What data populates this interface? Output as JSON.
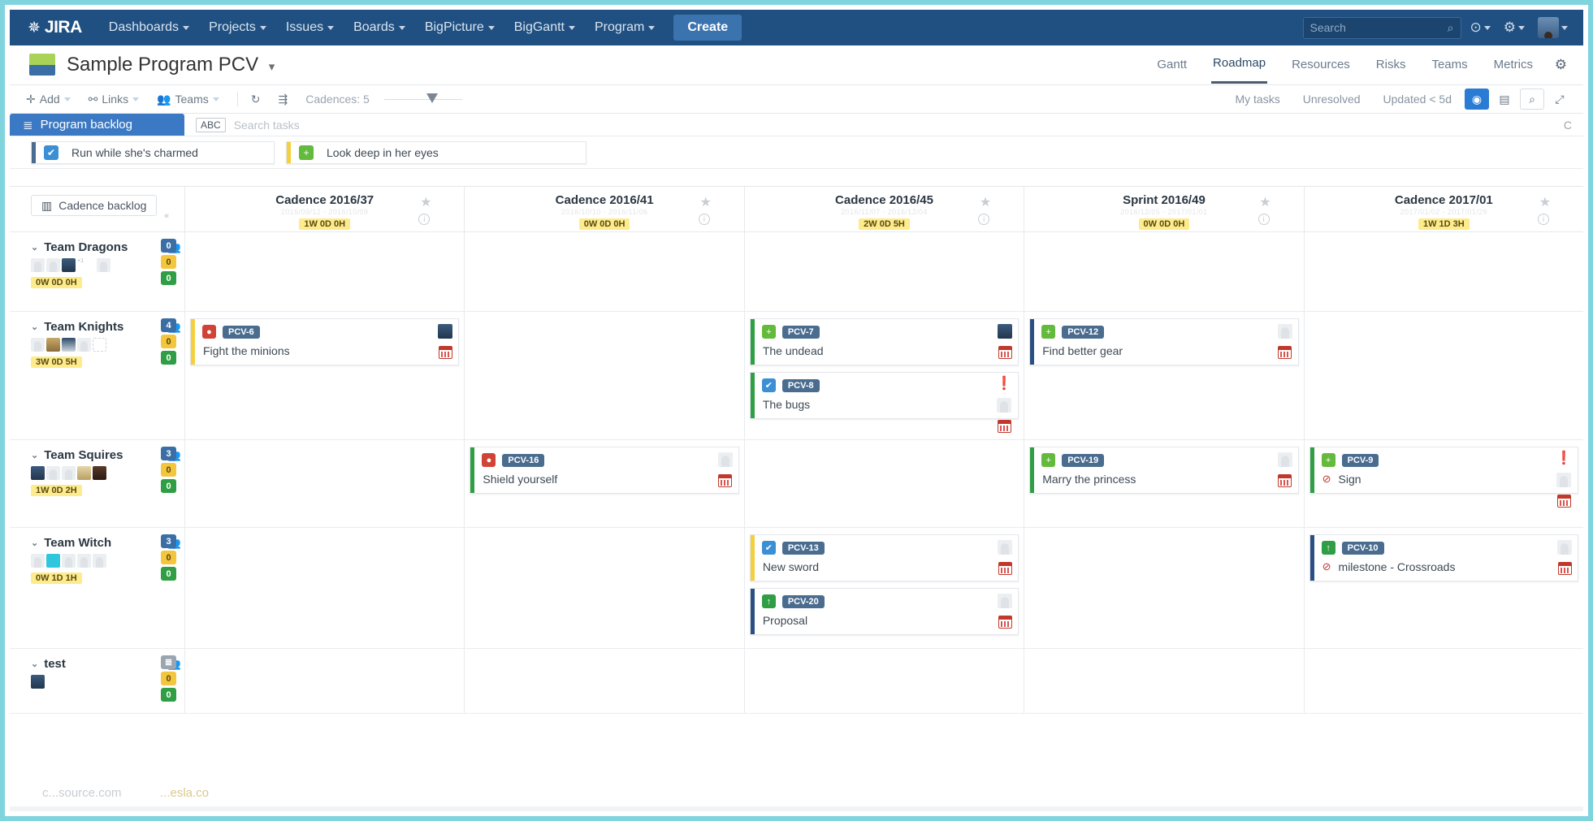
{
  "topnav": {
    "logo_mark": "✵",
    "logo_word": "JIRA",
    "items": [
      {
        "label": "Dashboards",
        "caret": true
      },
      {
        "label": "Projects",
        "caret": true
      },
      {
        "label": "Issues",
        "caret": true
      },
      {
        "label": "Boards",
        "caret": true
      },
      {
        "label": "BigPicture",
        "caret": true
      },
      {
        "label": "BigGantt",
        "caret": true
      },
      {
        "label": "Program",
        "caret": true
      }
    ],
    "create_label": "Create",
    "search_placeholder": "Search",
    "help_icon": "?",
    "settings_icon": "⚙"
  },
  "project": {
    "title": "Sample Program PCV",
    "title_caret": "▾",
    "tabs": [
      {
        "label": "Gantt",
        "active": false
      },
      {
        "label": "Roadmap",
        "active": true
      },
      {
        "label": "Resources",
        "active": false
      },
      {
        "label": "Risks",
        "active": false
      },
      {
        "label": "Teams",
        "active": false
      },
      {
        "label": "Metrics",
        "active": false
      }
    ],
    "settings_icon": "⚙"
  },
  "toolbar": {
    "add_label": "Add",
    "links_label": "Links",
    "teams_label": "Teams",
    "refresh_icon": "↻",
    "filter_icon": "⇶",
    "cadences_label": "Cadences: 5",
    "right": {
      "my_tasks": "My tasks",
      "unresolved": "Unresolved",
      "updated": "Updated < 5d",
      "bolt_icon": "⚡",
      "calendar_icon": "📅",
      "search_icon": "⌕",
      "expand_icon": "⤢"
    }
  },
  "backlog": {
    "tab_label": "Program backlog",
    "tab_icon": "≣",
    "abc_chip": "ABC",
    "search_placeholder": "Search tasks",
    "right_hint": "C",
    "items": [
      {
        "title": "Run while she's charmed",
        "type": "task",
        "type_glyph": "✔",
        "type_color": "#3b8fd4",
        "stripe": "#4a6c8f"
      },
      {
        "title": "Look deep in her eyes",
        "type": "story",
        "type_glyph": "+",
        "type_color": "#63ba3c",
        "stripe": "#f4d03f"
      }
    ]
  },
  "grid": {
    "cadence_backlog_label": "Cadence backlog",
    "cadence_backlog_icon": "▥",
    "collapse_icon": "«",
    "columns": [
      {
        "title": "Cadence 2016/37",
        "ghost": "2016/09/12 - 2016/10/09",
        "estimate": "1W 0D 0H"
      },
      {
        "title": "Cadence 2016/41",
        "ghost": "2016/10/10 - 2016/11/06",
        "estimate": "0W 0D 0H"
      },
      {
        "title": "Cadence 2016/45",
        "ghost": "2016/11/07 - 2016/12/04",
        "estimate": "2W 0D 5H"
      },
      {
        "title": "Sprint 2016/49",
        "ghost": "2016/12/05 - 2017/01/01",
        "estimate": "0W 0D 0H"
      },
      {
        "title": "Cadence 2017/01",
        "ghost": "2017/01/02 - 2017/01/29",
        "estimate": "1W 1D 3H"
      }
    ]
  },
  "teams": [
    {
      "name": "Team Dragons",
      "badges": {
        "blue": "0",
        "yellow": "0",
        "green": "0"
      },
      "estimate": "0W 0D 0H",
      "avatars": [
        "ghost",
        "ghost",
        "p1",
        "tiny",
        "ghost"
      ],
      "cells": [
        [],
        [],
        [],
        [],
        []
      ]
    },
    {
      "name": "Team Knights",
      "badges": {
        "blue": "4",
        "yellow": "0",
        "green": "0"
      },
      "estimate": "3W 0D 5H",
      "avatars": [
        "ghost",
        "p2",
        "p3",
        "ghost",
        "dots"
      ],
      "cells": [
        [
          {
            "key": "PCV-6",
            "summary": "Fight the minions",
            "type_glyph": "●",
            "type_color": "#d04437",
            "stripe": "#f4d03f",
            "avatar": "p1",
            "calendar": true,
            "warning": false,
            "blocked": false
          }
        ],
        [],
        [
          {
            "key": "PCV-7",
            "summary": "The undead",
            "type_glyph": "+",
            "type_color": "#63ba3c",
            "stripe": "#2f9e44",
            "avatar": "p1",
            "calendar": true,
            "warning": false,
            "blocked": false
          },
          {
            "key": "PCV-8",
            "summary": "The bugs",
            "type_glyph": "✔",
            "type_color": "#3b8fd4",
            "stripe": "#2f9e44",
            "avatar": "ghost",
            "calendar": true,
            "warning": true,
            "blocked": false
          }
        ],
        [
          {
            "key": "PCV-12",
            "summary": "Find better gear",
            "type_glyph": "+",
            "type_color": "#63ba3c",
            "stripe": "#2b4f81",
            "avatar": "ghost",
            "calendar": true,
            "warning": false,
            "blocked": false
          }
        ],
        []
      ]
    },
    {
      "name": "Team Squires",
      "badges": {
        "blue": "3",
        "yellow": "0",
        "green": "0"
      },
      "estimate": "1W 0D 2H",
      "avatars": [
        "p1",
        "ghost",
        "ghost",
        "p5",
        "p4"
      ],
      "cells": [
        [],
        [
          {
            "key": "PCV-16",
            "summary": "Shield yourself",
            "type_glyph": "●",
            "type_color": "#d04437",
            "stripe": "#2f9e44",
            "avatar": "ghost",
            "calendar": true,
            "warning": false,
            "blocked": false
          }
        ],
        [],
        [
          {
            "key": "PCV-19",
            "summary": "Marry the princess",
            "type_glyph": "+",
            "type_color": "#63ba3c",
            "stripe": "#2f9e44",
            "avatar": "ghost",
            "calendar": true,
            "warning": false,
            "blocked": false
          }
        ],
        [
          {
            "key": "PCV-9",
            "summary": "Sign",
            "type_glyph": "+",
            "type_color": "#63ba3c",
            "stripe": "#2f9e44",
            "avatar": "ghost",
            "calendar": true,
            "warning": true,
            "blocked": true
          }
        ]
      ]
    },
    {
      "name": "Team Witch",
      "badges": {
        "blue": "3",
        "yellow": "0",
        "green": "0"
      },
      "estimate": "0W 1D 1H",
      "avatars": [
        "ghost",
        "cyan",
        "ghost",
        "ghost",
        "ghost"
      ],
      "cells": [
        [],
        [],
        [
          {
            "key": "PCV-13",
            "summary": "New sword",
            "type_glyph": "✔",
            "type_color": "#3b8fd4",
            "stripe": "#f4d03f",
            "avatar": "ghost",
            "calendar": true,
            "warning": false,
            "blocked": false
          },
          {
            "key": "PCV-20",
            "summary": "Proposal",
            "type_glyph": "↑",
            "type_color": "#2f9e44",
            "stripe": "#2b4f81",
            "avatar": "ghost",
            "calendar": true,
            "warning": false,
            "blocked": false
          }
        ],
        [],
        [
          {
            "key": "PCV-10",
            "summary": "milestone - Crossroads",
            "type_glyph": "↑",
            "type_color": "#2f9e44",
            "stripe": "#2b4f81",
            "avatar": "ghost",
            "calendar": true,
            "warning": false,
            "blocked": true
          }
        ]
      ]
    },
    {
      "name": "test",
      "badges": {
        "blue": "",
        "yellow": "0",
        "green": "0"
      },
      "estimate": "",
      "avatars": [
        "p1"
      ],
      "cells": [
        [],
        [],
        [],
        [],
        []
      ]
    }
  ],
  "watermark": {
    "left": "c...source.com",
    "right": "...esla.co"
  }
}
